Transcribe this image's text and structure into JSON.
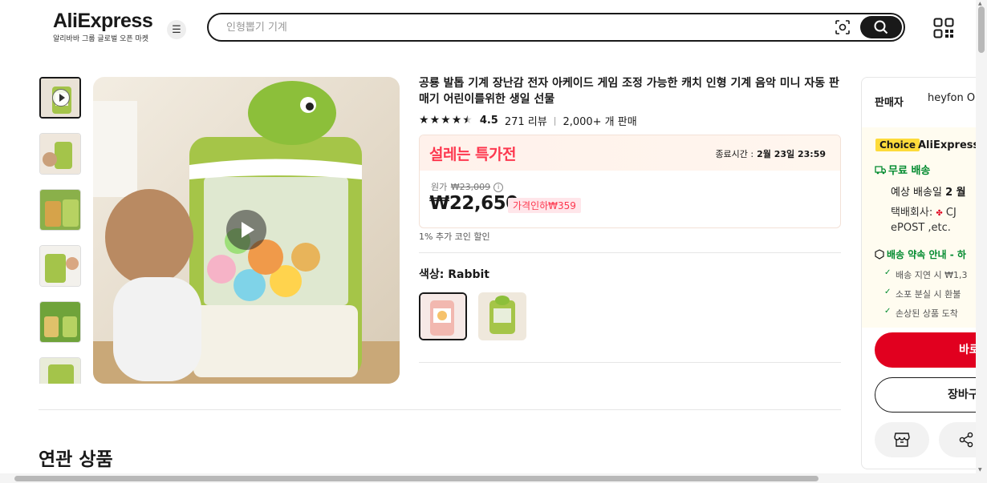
{
  "header": {
    "logo_text": "AliExpress",
    "logo_sub": "알리바바 그룹 글로벌 오픈 마켓",
    "search_placeholder": "인형뽑기 기계"
  },
  "product": {
    "title": "공룡 발톱 기계 장난감 전자 아케이드 게임 조정 가능한 캐치 인형 기계 음악 미니 자동 판매기 어린이를위한 생일 선물",
    "rating": "4.5",
    "rating_stars": 4.5,
    "reviews": "271 리뷰",
    "sales": "2,000+ 개 판매",
    "deal_label": "설레는 특가전",
    "deal_end_label": "종료시간 :",
    "deal_end_time": "2월 23일 23:59",
    "original_label": "원가",
    "original_price": "₩23,009",
    "price": "₩22,650",
    "discount": "가격인하₩359",
    "coin": "1% 추가 코인 할인",
    "color_label": "색상:",
    "color_value": "Rabbit",
    "related_title": "연관 상품"
  },
  "panel": {
    "seller_label": "판매자",
    "seller_name": "heyfon O",
    "choice_badge": "Choice",
    "choice_name": "AliExpress",
    "free_shipping": "무료 배송",
    "estimate_prefix": "예상 배송일",
    "estimate_bold": "2 월",
    "carrier_label": "택배회사:",
    "carrier_name": "CJ",
    "carrier_more": "ePOST ,etc.",
    "promise": "배송 약속 안내 - 하",
    "checks": [
      "배송 지연 시 ₩1,3",
      "소포 분실 시 환불",
      "손상된 상품 도착"
    ],
    "buy_label": "바로",
    "cart_label": "장바구"
  },
  "colors": {
    "brand_red": "#fd384f",
    "buy_red": "#e1001f",
    "choice_yellow": "#fddb3a",
    "green": "#008a2e"
  }
}
